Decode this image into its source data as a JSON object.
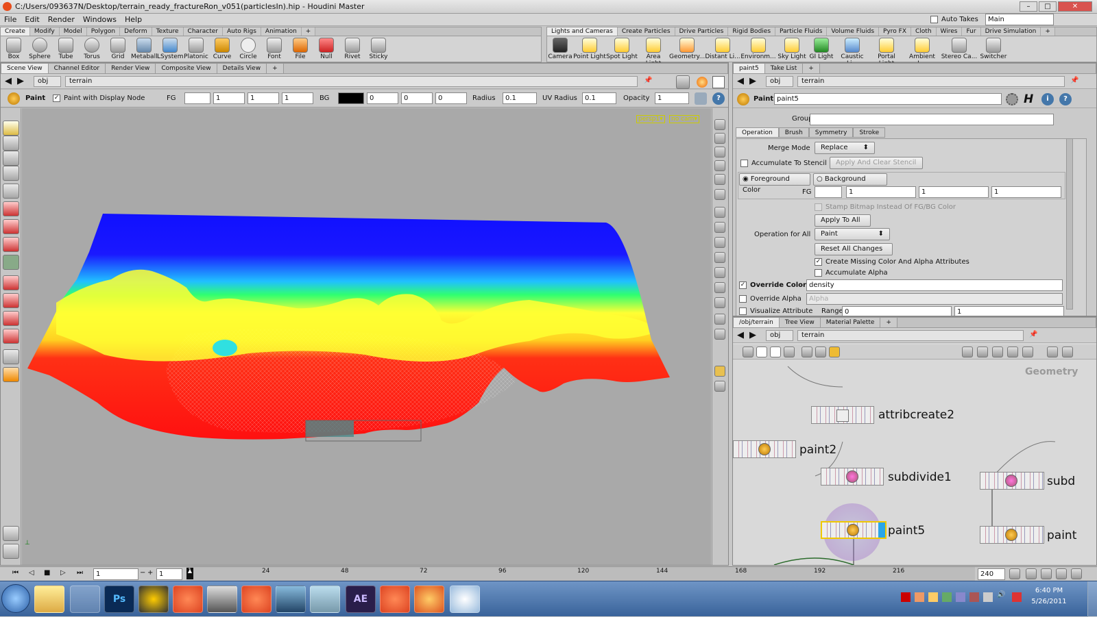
{
  "window": {
    "title": "C:/Users/093637N/Desktop/terrain_ready_fractureRon_v051(particlesIn).hip - Houdini Master",
    "auto_takes": "Auto Takes",
    "desktop": "Main"
  },
  "menu": [
    "File",
    "Edit",
    "Render",
    "Windows",
    "Help"
  ],
  "shelf_left": {
    "tabs": [
      "Create",
      "Modify",
      "Model",
      "Polygon",
      "Deform",
      "Texture",
      "Character",
      "Auto Rigs",
      "Animation"
    ],
    "tools": [
      "Box",
      "Sphere",
      "Tube",
      "Torus",
      "Grid",
      "Metaball",
      "LSystem",
      "Platonic ...",
      "Curve",
      "Circle",
      "Font",
      "File",
      "Null",
      "Rivet",
      "Sticky"
    ]
  },
  "shelf_right": {
    "tabs": [
      "Lights and Cameras",
      "Create Particles",
      "Drive Particles",
      "Rigid Bodies",
      "Particle Fluids",
      "Volume Fluids",
      "Pyro FX",
      "Cloth",
      "Wires",
      "Fur",
      "Drive Simulation"
    ],
    "tools": [
      "Camera",
      "Point Light",
      "Spot Light",
      "Area Light",
      "Geometry...",
      "Distant Li...",
      "Environm...",
      "Sky Light",
      "GI Light",
      "Caustic Li...",
      "Portal Light",
      "Ambient L...",
      "Stereo Ca...",
      "Switcher"
    ]
  },
  "viewport": {
    "tabs": [
      "Scene View",
      "Channel Editor",
      "Render View",
      "Composite View",
      "Details View"
    ],
    "path_obj": "obj",
    "path_node": "terrain",
    "tool_name": "Paint",
    "paint_display": "Paint with Display Node",
    "fg_label": "FG",
    "fg": [
      "1",
      "1",
      "1"
    ],
    "bg_label": "BG",
    "bg": [
      "0",
      "0",
      "0"
    ],
    "radius_label": "Radius",
    "radius": "0.1",
    "uv_radius_label": "UV Radius",
    "uv_radius": "0.1",
    "opacity_label": "Opacity",
    "opacity": "1",
    "cam": "persp1",
    "cam2": "no cam"
  },
  "params": {
    "tabs": [
      "paint5",
      "Take List"
    ],
    "path_obj": "obj",
    "path_node": "terrain",
    "node_type": "Paint",
    "node_name": "paint5",
    "group_label": "Group",
    "subtabs": [
      "Operation",
      "Brush",
      "Symmetry",
      "Stroke"
    ],
    "merge_mode_label": "Merge Mode",
    "merge_mode": "Replace",
    "accum_stencil": "Accumulate To Stencil",
    "apply_clear": "Apply And Clear Stencil",
    "fg_color": "Foreground Color",
    "bg_color": "Background Color",
    "fg_label": "FG",
    "fg": [
      "1",
      "1",
      "1"
    ],
    "stamp_bitmap": "Stamp Bitmap Instead Of FG/BG Color",
    "apply_all": "Apply To All",
    "op_all_label": "Operation for All",
    "op_all": "Paint",
    "reset": "Reset All Changes",
    "create_missing": "Create Missing Color And Alpha Attributes",
    "accum_alpha": "Accumulate Alpha",
    "override_color": "Override Color",
    "override_color_val": "density",
    "override_alpha": "Override Alpha",
    "override_alpha_val": "Alpha",
    "visualize": "Visualize Attribute",
    "range_label": "Range",
    "range": [
      "0",
      "1"
    ]
  },
  "network": {
    "tabs": [
      "/obj/terrain",
      "Tree View",
      "Material Palette"
    ],
    "path_obj": "obj",
    "path_node": "terrain",
    "context": "Geometry",
    "nodes": [
      "attribcreate2",
      "paint2",
      "subdivide1",
      "paint5",
      "subd",
      "paint"
    ]
  },
  "timeline": {
    "frame": "1",
    "start": "1",
    "end": "240",
    "ticks": [
      "1",
      "24",
      "48",
      "72",
      "96",
      "120",
      "144",
      "168",
      "192",
      "216"
    ]
  },
  "taskbar": {
    "time": "6:40 PM",
    "date": "5/26/2011",
    "apps": [
      "Explorer",
      "Notepad",
      "Photoshop",
      "Nuke",
      "Houdini",
      "Maya",
      "Houdini",
      "Preview",
      "Notes",
      "After Effects",
      "Houdini",
      "Firefox",
      "Paint"
    ],
    "app_text": {
      "photoshop": "Ps",
      "after_effects": "AE"
    }
  },
  "colors": {
    "terrain_blue": "#1010ff",
    "terrain_yellow": "#ffff33",
    "terrain_red": "#ff1515",
    "selection": "#f0c800"
  }
}
